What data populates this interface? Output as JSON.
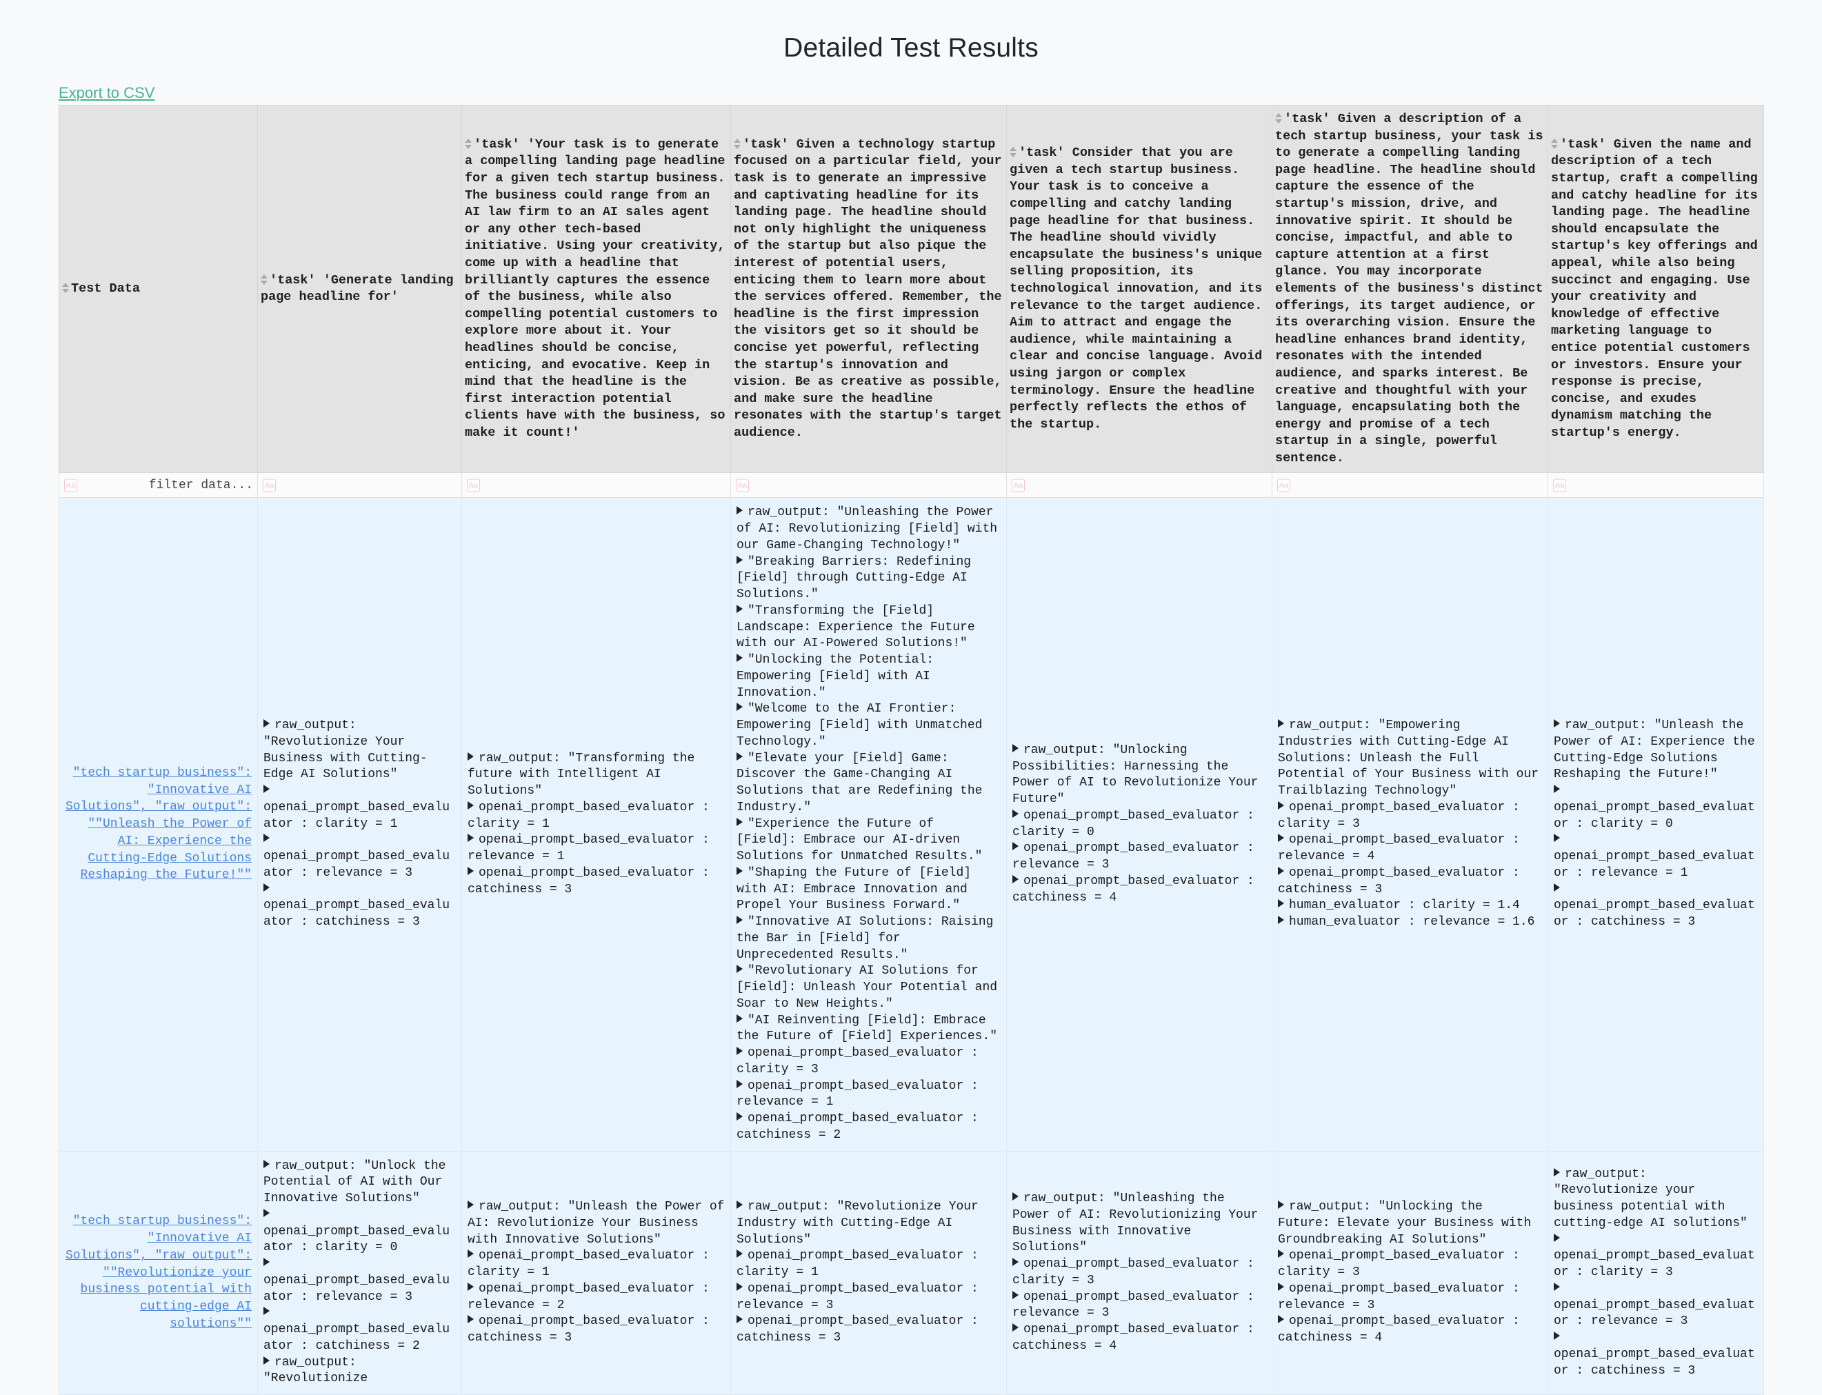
{
  "header": {
    "title": "Detailed Test Results",
    "export_label": "Export to CSV"
  },
  "table": {
    "filter_placeholder": "filter data...",
    "filter_icon": "aa-icon",
    "sort_icon": "sort-updown-icon",
    "columns": [
      {
        "id": "test_data",
        "label": "Test Data"
      },
      {
        "id": "col1",
        "label": "'task' 'Generate landing page headline for'"
      },
      {
        "id": "col2",
        "label": "'task' 'Your task is to generate a compelling landing page headline for a given tech startup business. The business could range from an AI law firm to an AI sales agent or any other tech-based initiative. Using your creativity, come up with a headline that brilliantly captures the essence of the business, while also compelling potential customers to explore more about it. Your headlines should be concise, enticing, and evocative. Keep in mind that the headline is the first interaction potential clients have with the business, so make it count!'"
      },
      {
        "id": "col3",
        "label": "'task' Given a technology startup focused on a particular field, your task is to generate an impressive and captivating headline for its landing page. The headline should not only highlight the uniqueness of the startup but also pique the interest of potential users, enticing them to learn more about the services offered. Remember, the headline is the first impression the visitors get so it should be concise yet powerful, reflecting the startup's innovation and vision. Be as creative as possible, and make sure the headline resonates with the startup's target audience."
      },
      {
        "id": "col4",
        "label": "'task' Consider that you are given a tech startup business. Your task is to conceive a compelling and catchy landing page headline for that business. The headline should vividly encapsulate the business's unique selling proposition, its technological innovation, and its relevance to the target audience. Aim to attract and engage the audience, while maintaining a clear and concise language. Avoid using jargon or complex terminology. Ensure the headline perfectly reflects the ethos of the startup."
      },
      {
        "id": "col5",
        "label": "'task' Given a description of a tech startup business, your task is to generate a compelling landing page headline. The headline should capture the essence of the startup's mission, drive, and innovative spirit. It should be concise, impactful, and able to capture attention at a first glance. You may incorporate elements of the business's distinct offerings, its target audience, or its overarching vision. Ensure the headline enhances brand identity, resonates with the intended audience, and sparks interest. Be creative and thoughtful with your language, encapsulating both the energy and promise of a tech startup in a single, powerful sentence."
      },
      {
        "id": "col6",
        "label": "'task' Given the name and description of a tech startup, craft a compelling and catchy headline for its landing page. The headline should encapsulate the startup's key offerings and appeal, while also being succinct and engaging. Use your creativity and knowledge of effective marketing language to entice potential customers or investors. Ensure your response is precise, concise, and exudes dynamism matching the startup's energy."
      }
    ],
    "rows": [
      {
        "test_data": "\"tech_startup_business\": \"Innovative AI Solutions\", \"raw_output\": \"\"Unleash the Power of AI: Experience the Cutting-Edge Solutions Reshaping the Future!\"\"",
        "cells": [
          [
            {
              "text": "raw_output: \"Revolutionize Your Business with Cutting-Edge AI Solutions\"",
              "gap": false
            },
            {
              "text": "openai_prompt_based_evaluator : clarity = 1",
              "gap": false
            },
            {
              "text": "openai_prompt_based_evaluator : relevance = 3",
              "gap": false
            },
            {
              "text": "openai_prompt_based_evaluator : catchiness = 3",
              "gap": false
            }
          ],
          [
            {
              "text": "raw_output: \"Transforming the future with Intelligent AI Solutions\"",
              "gap": false
            },
            {
              "text": "openai_prompt_based_evaluator : clarity = 1",
              "gap": false
            },
            {
              "text": "openai_prompt_based_evaluator : relevance = 1",
              "gap": false
            },
            {
              "text": "openai_prompt_based_evaluator : catchiness = 3",
              "gap": false
            }
          ],
          [
            {
              "text": "raw_output: \"Unleashing the Power of AI: Revolutionizing [Field] with our Game-Changing Technology!\"",
              "gap": false
            },
            {
              "text": "\"Breaking Barriers: Redefining [Field] through Cutting-Edge AI Solutions.\"",
              "gap": true
            },
            {
              "text": "\"Transforming the [Field] Landscape: Experience the Future with our AI-Powered Solutions!\"",
              "gap": true
            },
            {
              "text": "\"Unlocking the Potential: Empowering [Field] with AI Innovation.\"",
              "gap": true
            },
            {
              "text": "\"Welcome to the AI Frontier: Empowering [Field] with Unmatched Technology.\"",
              "gap": true
            },
            {
              "text": "\"Elevate your [Field] Game: Discover the Game-Changing AI Solutions that are Redefining the Industry.\"",
              "gap": true
            },
            {
              "text": "\"Experience the Future of [Field]: Embrace our AI-driven Solutions for Unmatched Results.\"",
              "gap": true
            },
            {
              "text": "\"Shaping the Future of [Field] with AI: Embrace Innovation and Propel Your Business Forward.\"",
              "gap": true
            },
            {
              "text": "\"Innovative AI Solutions: Raising the Bar in [Field] for Unprecedented Results.\"",
              "gap": true
            },
            {
              "text": "\"Revolutionary AI Solutions for [Field]: Unleash Your Potential and Soar to New Heights.\"",
              "gap": true
            },
            {
              "text": "\"AI Reinventing [Field]: Embrace the Future of [Field] Experiences.\"",
              "gap": true
            },
            {
              "text": "openai_prompt_based_evaluator : clarity = 3",
              "gap": false
            },
            {
              "text": "openai_prompt_based_evaluator : relevance = 1",
              "gap": false
            },
            {
              "text": "openai_prompt_based_evaluator : catchiness = 2",
              "gap": false
            }
          ],
          [
            {
              "text": "raw_output: \"Unlocking Possibilities: Harnessing the Power of AI to Revolutionize Your Future\"",
              "gap": false
            },
            {
              "text": "openai_prompt_based_evaluator : clarity = 0",
              "gap": false
            },
            {
              "text": "openai_prompt_based_evaluator : relevance = 3",
              "gap": false
            },
            {
              "text": "openai_prompt_based_evaluator : catchiness = 4",
              "gap": false
            }
          ],
          [
            {
              "text": "raw_output: \"Empowering Industries with Cutting-Edge AI Solutions: Unleash the Full Potential of Your Business with our Trailblazing Technology\"",
              "gap": false
            },
            {
              "text": "openai_prompt_based_evaluator : clarity = 3",
              "gap": false
            },
            {
              "text": "openai_prompt_based_evaluator : relevance = 4",
              "gap": false
            },
            {
              "text": "openai_prompt_based_evaluator : catchiness = 3",
              "gap": false
            },
            {
              "text": "human_evaluator : clarity = 1.4",
              "gap": false
            },
            {
              "text": "human_evaluator : relevance = 1.6",
              "gap": false
            }
          ],
          [
            {
              "text": "raw_output: \"Unleash the Power of AI: Experience the Cutting-Edge Solutions Reshaping the Future!\"",
              "gap": false
            },
            {
              "text": "openai_prompt_based_evaluator : clarity = 0",
              "gap": false
            },
            {
              "text": "openai_prompt_based_evaluator : relevance = 1",
              "gap": false
            },
            {
              "text": "openai_prompt_based_evaluator : catchiness = 3",
              "gap": false
            }
          ]
        ]
      },
      {
        "test_data": "\"tech_startup_business\": \"Innovative AI Solutions\", \"raw_output\": \"\"Revolutionize your business potential with cutting-edge AI solutions\"\"",
        "cells": [
          [
            {
              "text": "raw_output: \"Unlock the Potential of AI with Our Innovative Solutions\"",
              "gap": false
            },
            {
              "text": "openai_prompt_based_evaluator : clarity = 0",
              "gap": false
            },
            {
              "text": "openai_prompt_based_evaluator : relevance = 3",
              "gap": false
            },
            {
              "text": "openai_prompt_based_evaluator : catchiness = 2",
              "gap": false
            },
            {
              "text": "raw_output: \"Revolutionize",
              "gap": false
            }
          ],
          [
            {
              "text": "raw_output: \"Unleash the Power of AI: Revolutionize Your Business with Innovative Solutions\"",
              "gap": false
            },
            {
              "text": "openai_prompt_based_evaluator : clarity = 1",
              "gap": false
            },
            {
              "text": "openai_prompt_based_evaluator : relevance = 2",
              "gap": false
            },
            {
              "text": "openai_prompt_based_evaluator : catchiness = 3",
              "gap": false
            }
          ],
          [
            {
              "text": "raw_output: \"Revolutionize Your Industry with Cutting-Edge AI Solutions\"",
              "gap": false
            },
            {
              "text": "openai_prompt_based_evaluator : clarity = 1",
              "gap": false
            },
            {
              "text": "openai_prompt_based_evaluator : relevance = 3",
              "gap": false
            },
            {
              "text": "openai_prompt_based_evaluator : catchiness = 3",
              "gap": false
            }
          ],
          [
            {
              "text": "raw_output: \"Unleashing the Power of AI: Revolutionizing Your Business with Innovative Solutions\"",
              "gap": false
            },
            {
              "text": "openai_prompt_based_evaluator : clarity = 3",
              "gap": false
            },
            {
              "text": "openai_prompt_based_evaluator : relevance = 3",
              "gap": false
            },
            {
              "text": "openai_prompt_based_evaluator : catchiness = 4",
              "gap": false
            }
          ],
          [
            {
              "text": "raw_output: \"Unlocking the Future: Elevate your Business with Groundbreaking AI Solutions\"",
              "gap": false
            },
            {
              "text": "openai_prompt_based_evaluator : clarity = 3",
              "gap": false
            },
            {
              "text": "openai_prompt_based_evaluator : relevance = 3",
              "gap": false
            },
            {
              "text": "openai_prompt_based_evaluator : catchiness = 4",
              "gap": false
            }
          ],
          [
            {
              "text": "raw_output: \"Revolutionize your business potential with cutting-edge AI solutions\"",
              "gap": false
            },
            {
              "text": "openai_prompt_based_evaluator : clarity = 3",
              "gap": false
            },
            {
              "text": "openai_prompt_based_evaluator : relevance = 3",
              "gap": false
            },
            {
              "text": "openai_prompt_based_evaluator : catchiness = 3",
              "gap": false
            }
          ]
        ]
      }
    ]
  },
  "colors": {
    "accent_link": "#4ab391",
    "data_link": "#4a84d8",
    "header_bg": "#e3e3e3",
    "row_bg": "#e8f4fd",
    "page_bg": "#f8f9fa"
  }
}
